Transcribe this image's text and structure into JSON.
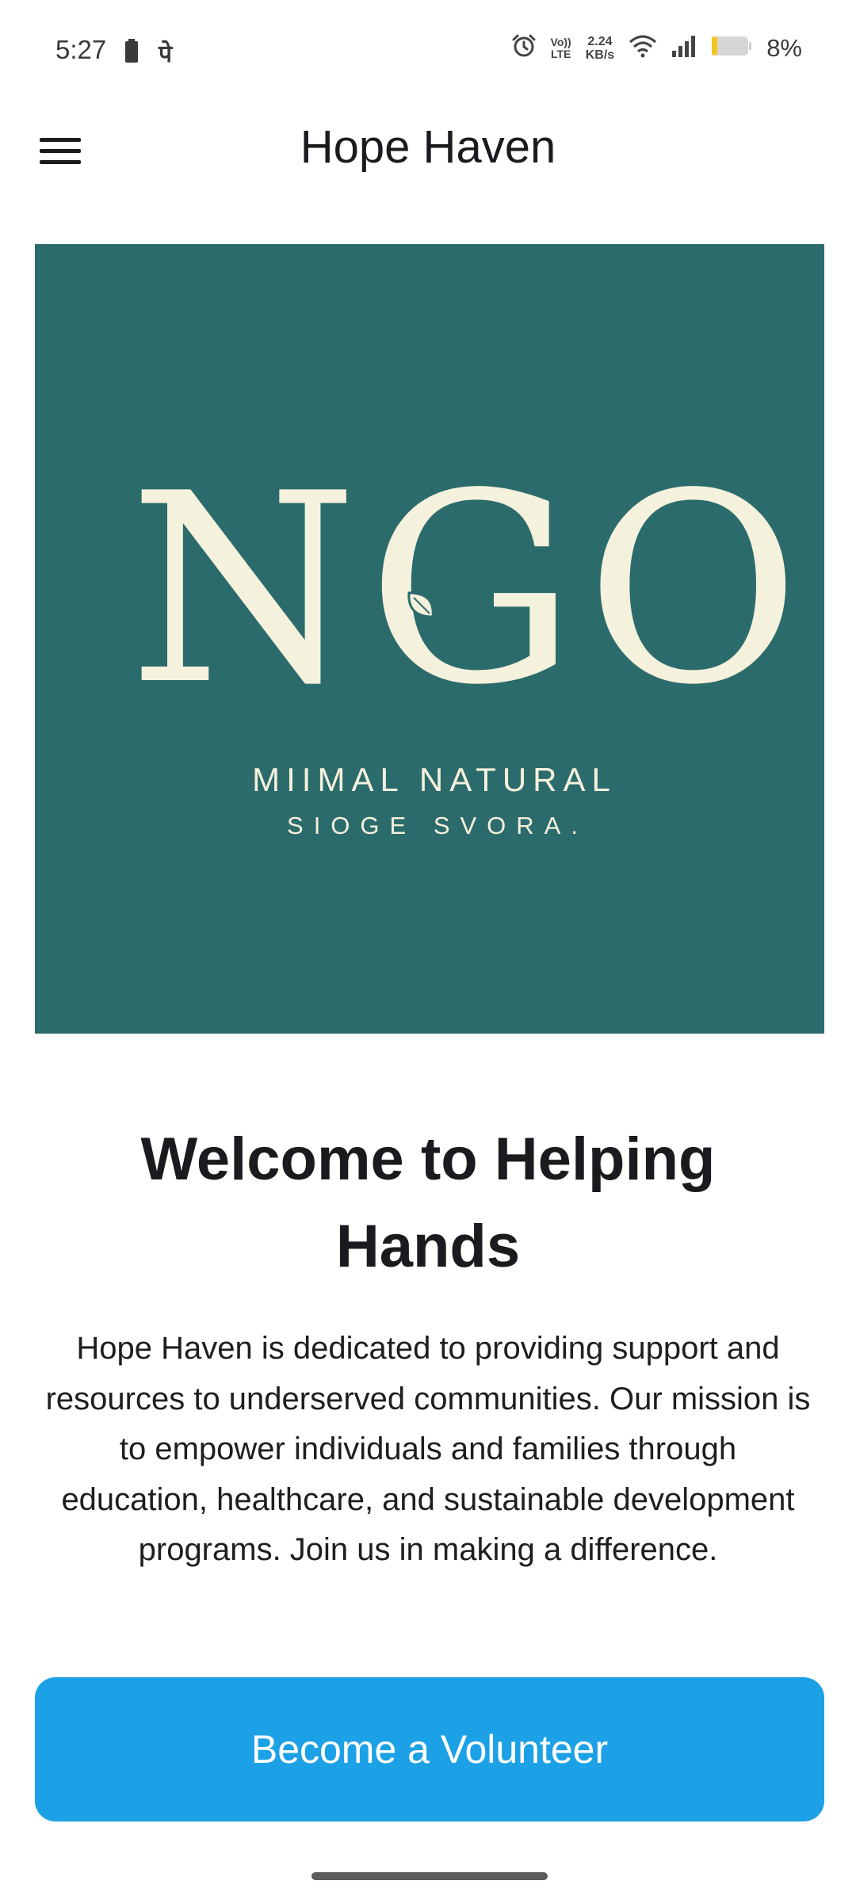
{
  "status_bar": {
    "time": "5:27",
    "extra_glyph": "पे",
    "lte_top": "Vo))",
    "lte_bottom": "LTE",
    "speed_value": "2.24",
    "speed_unit": "KB/s",
    "battery_percent": "8%",
    "icons": [
      "battery-saver-icon",
      "alarm-icon",
      "wifi-icon",
      "signal-icon",
      "battery-icon"
    ]
  },
  "app_bar": {
    "title": "Hope Haven",
    "menu_icon": "hamburger-menu-icon"
  },
  "hero": {
    "logo_text": "NGO",
    "line1": "MIIMAL NATURAL",
    "line2": "SIOGE SVORA.",
    "background_color": "#2c6b6c",
    "logo_color": "#f4f1dc"
  },
  "content": {
    "title": "Welcome to Helping Hands",
    "body": "Hope Haven is dedicated to providing support and resources to underserved communities. Our mission is to empower individuals and families through education, healthcare, and sustainable development programs. Join us in making a difference.",
    "cta_label": "Become a Volunteer",
    "cta_color": "#1ca1e6"
  }
}
